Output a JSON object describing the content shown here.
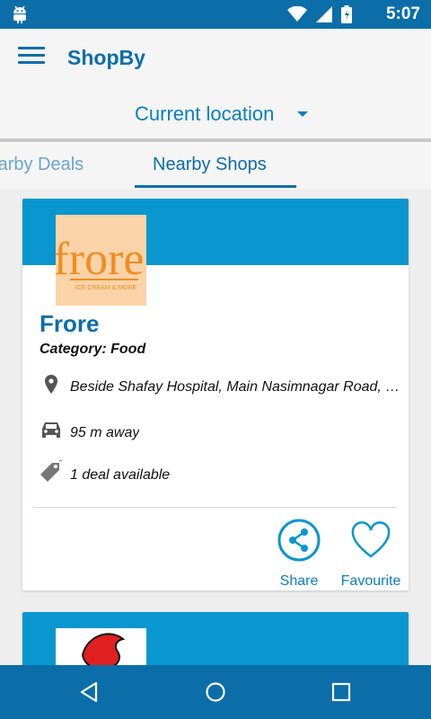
{
  "status_bar": {
    "time": "5:07",
    "icons": [
      "android-icon",
      "wifi-icon",
      "signal-icon",
      "battery-icon"
    ]
  },
  "app_bar": {
    "title": "ShopBy",
    "menu_icon": "hamburger-menu-icon"
  },
  "location": {
    "label": "Current location",
    "icon": "dropdown-caret-icon"
  },
  "tabs": [
    {
      "label": "Nearby Deals",
      "selected": false
    },
    {
      "label": "Nearby Shops",
      "selected": true
    }
  ],
  "shops": [
    {
      "logo_text": "frore",
      "logo_subtext": "ICE CREAM & MORE",
      "name": "Frore",
      "category": "Category: Food",
      "address": "Beside Shafay Hospital, Main Nasimnagar Road, Hyderabad",
      "distance": "95 m away",
      "deals": "1 deal available",
      "share_label": "Share",
      "favourite_label": "Favourite"
    }
  ],
  "colors": {
    "primary": "#0b6ea8",
    "accent": "#0a96cf",
    "logo_bg": "#fbd3a8",
    "logo_orange": "#f28c1e"
  },
  "nav_bar": {
    "icons": [
      "back-icon",
      "home-icon",
      "recents-icon"
    ]
  }
}
